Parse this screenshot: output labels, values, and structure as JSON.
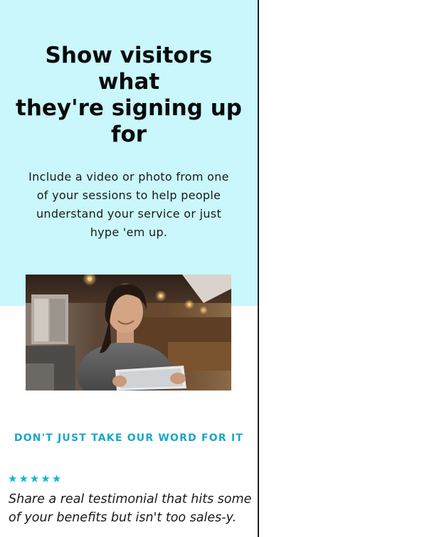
{
  "hero": {
    "title_lines": [
      "Show visitors",
      "what",
      "they're signing up",
      "for"
    ],
    "description_lines": [
      "Include a video or photo from one",
      "of your sessions to help people",
      "understand your service or just",
      "hype 'em up."
    ],
    "image_alt": "woman-using-tablet-photo"
  },
  "testimonials": {
    "eyebrow": "DON'T JUST TAKE OUR WORD FOR IT",
    "rating": {
      "stars": [
        "★",
        "★",
        "★",
        "★",
        "★"
      ],
      "value": 5,
      "max": 5
    },
    "quote_lines": [
      "Share a real testimonial that hits some",
      "of your benefits but isn't too sales-y."
    ]
  },
  "colors": {
    "hero_background": "#c9f7fb",
    "accent": "#19a7c9",
    "star": "#12b8c4",
    "divider": "#1f1f1f"
  }
}
